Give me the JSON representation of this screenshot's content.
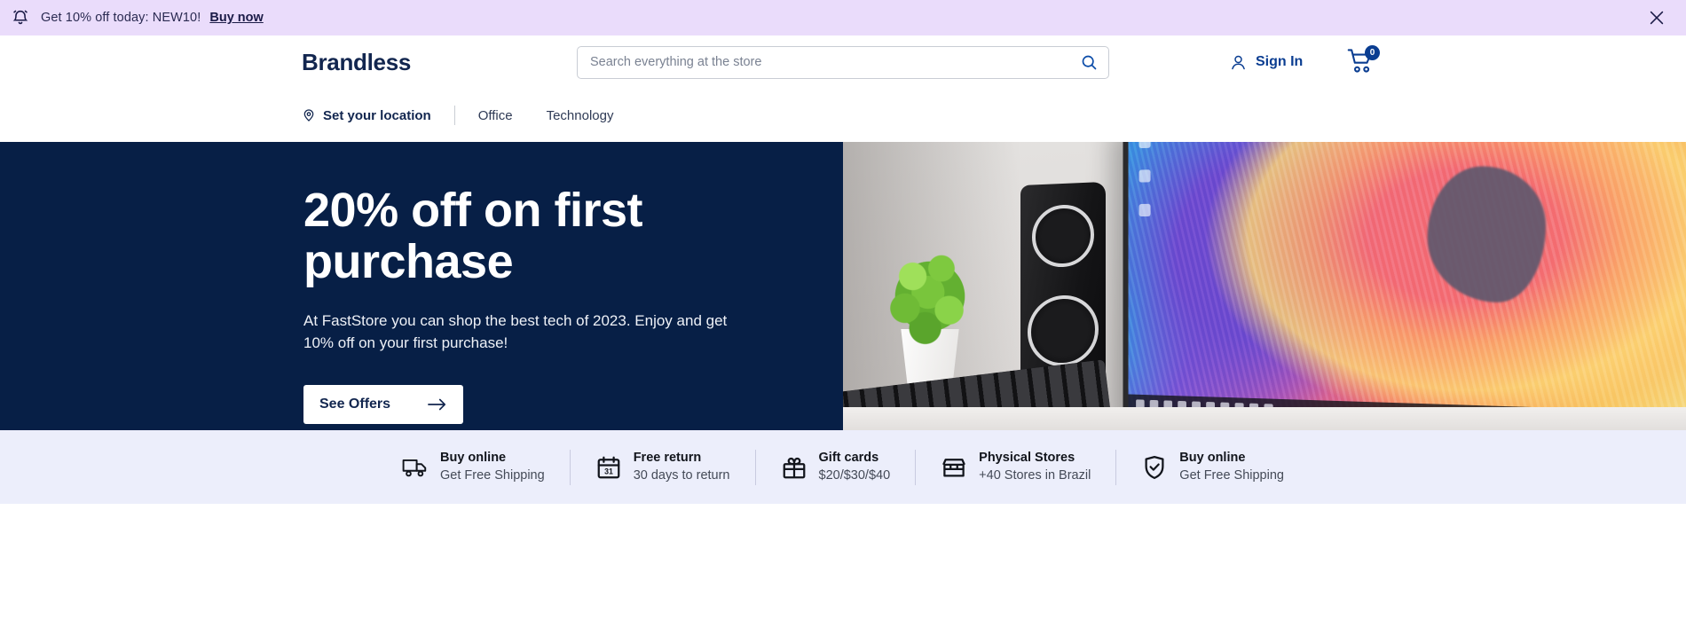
{
  "banner": {
    "icon": "bell-icon",
    "text": "Get 10% off today: NEW10!",
    "link_label": "Buy now",
    "close_icon": "close-icon",
    "background": "#eadcfb"
  },
  "header": {
    "logo": "Brandless",
    "search": {
      "placeholder": "Search everything at the store",
      "value": "",
      "icon": "search-icon"
    },
    "account": {
      "label": "Sign In",
      "icon": "user-icon"
    },
    "cart": {
      "icon": "cart-icon",
      "count": "0"
    },
    "accent_color": "#0a3d91"
  },
  "nav": {
    "location": {
      "label": "Set your location",
      "icon": "location-pin-icon"
    },
    "links": [
      {
        "label": "Office"
      },
      {
        "label": "Technology"
      }
    ]
  },
  "hero": {
    "title": "20% off on first purchase",
    "subtitle": "At FastStore you can shop the best tech of 2023. Enjoy and get 10% off on your first purchase!",
    "cta_label": "See Offers",
    "cta_icon": "arrow-right-icon",
    "background": "#071f46",
    "image_alt": "desk-with-monitor-speakers-plant-keyboard"
  },
  "features": [
    {
      "icon": "truck-icon",
      "title": "Buy online",
      "desc": "Get Free Shipping"
    },
    {
      "icon": "calendar-icon",
      "title": "Free return",
      "desc": "30 days to return"
    },
    {
      "icon": "gift-icon",
      "title": "Gift cards",
      "desc": "$20/$30/$40"
    },
    {
      "icon": "store-icon",
      "title": "Physical Stores",
      "desc": "+40 Stores in Brazil"
    },
    {
      "icon": "shield-check-icon",
      "title": "Buy online",
      "desc": "Get Free Shipping"
    }
  ]
}
